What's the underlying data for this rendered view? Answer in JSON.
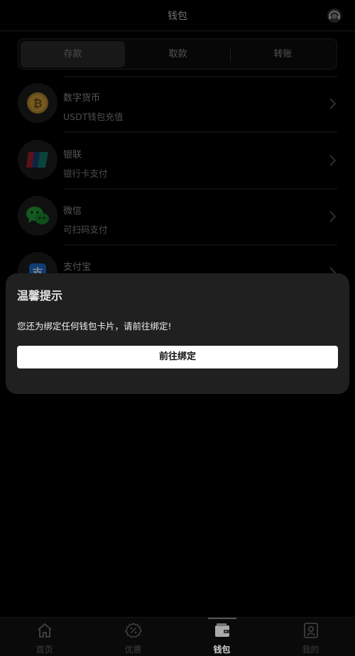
{
  "header": {
    "title": "钱包"
  },
  "segment": {
    "tabs": [
      "存款",
      "取款",
      "转账"
    ],
    "active": 0
  },
  "methods": [
    {
      "name": "数字货币",
      "desc": "USDT钱包充值",
      "icon": "bitcoin-icon"
    },
    {
      "name": "银联",
      "desc": "银行卡支付",
      "icon": "unionpay-icon"
    },
    {
      "name": "微信",
      "desc": "可扫码支付",
      "icon": "wechat-icon"
    },
    {
      "name": "支付宝",
      "desc": "",
      "icon": "alipay-icon"
    }
  ],
  "dialog": {
    "title": "温馨提示",
    "message": "您还为绑定任何钱包卡片，请前往绑定!",
    "button": "前往绑定"
  },
  "tabbar": {
    "items": [
      {
        "label": "首页",
        "icon": "home-icon"
      },
      {
        "label": "优惠",
        "icon": "discount-icon"
      },
      {
        "label": "钱包",
        "icon": "wallet-icon"
      },
      {
        "label": "我的",
        "icon": "profile-icon"
      }
    ],
    "active": 2
  },
  "colors": {
    "background": "#000000",
    "dialog": "#202020",
    "button": "#ffffff"
  }
}
